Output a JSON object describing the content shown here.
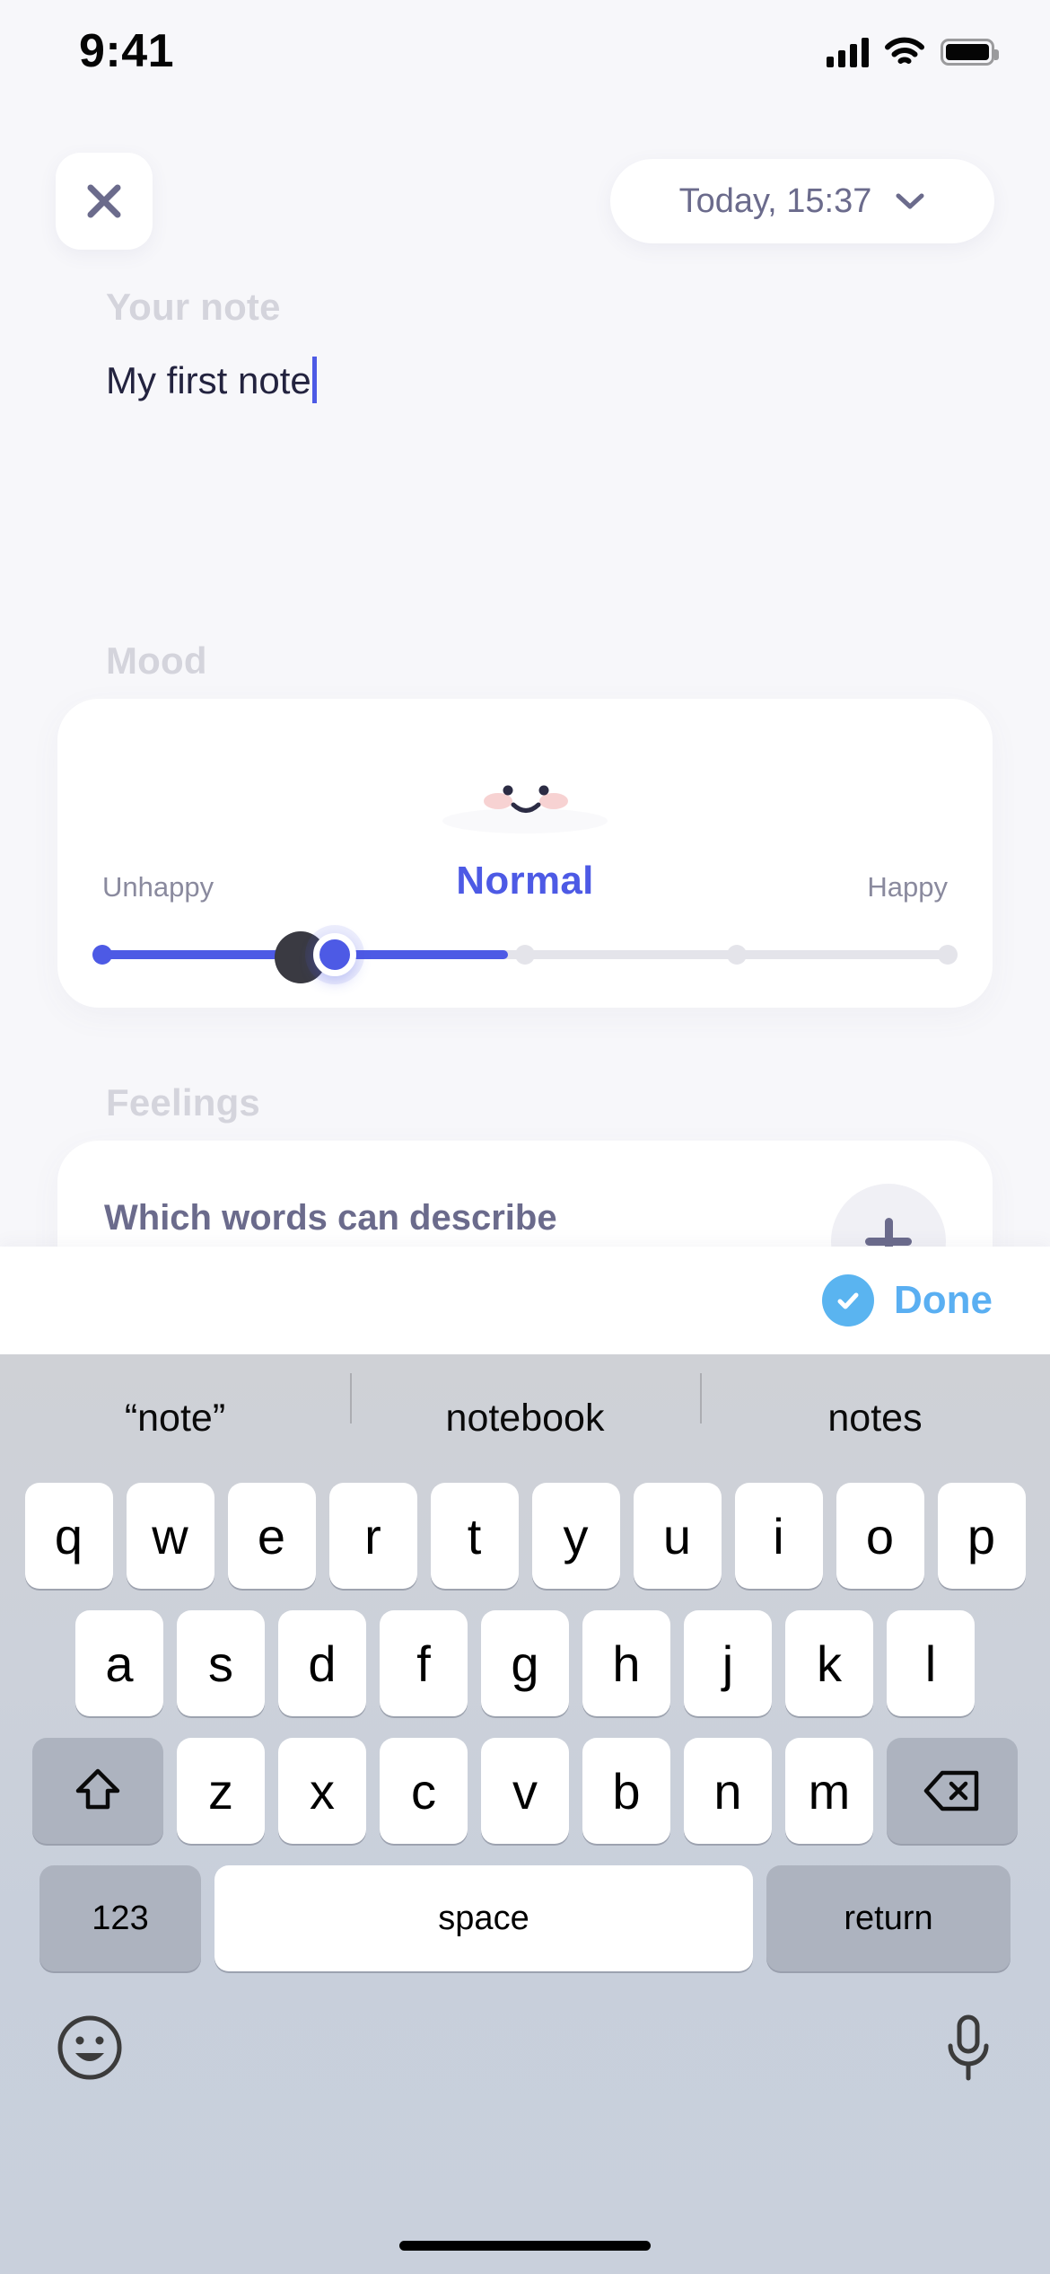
{
  "status_bar": {
    "time": "9:41",
    "cellular_icon": "signal-bars-icon",
    "wifi_icon": "wifi-icon",
    "battery_icon": "battery-icon"
  },
  "header": {
    "close_icon": "close-icon",
    "date_text": "Today, 15:37",
    "chevron_icon": "chevron-down-icon"
  },
  "note": {
    "label": "Your note",
    "value": "My first note"
  },
  "mood": {
    "label": "Mood",
    "emoji_icon": "cloud-smile-icon",
    "value": "Normal",
    "left_label": "Unhappy",
    "right_label": "Happy",
    "steps": 5,
    "selected_index": 2
  },
  "feelings": {
    "label": "Feelings",
    "question": "Which words can describe",
    "add_icon": "plus-icon"
  },
  "toolbar": {
    "done_label": "Done",
    "check_icon": "check-circle-icon"
  },
  "keyboard": {
    "suggestions": [
      "“note”",
      "notebook",
      "notes"
    ],
    "row1": [
      "q",
      "w",
      "e",
      "r",
      "t",
      "y",
      "u",
      "i",
      "o",
      "p"
    ],
    "row2": [
      "a",
      "s",
      "d",
      "f",
      "g",
      "h",
      "j",
      "k",
      "l"
    ],
    "row3": [
      "z",
      "x",
      "c",
      "v",
      "b",
      "n",
      "m"
    ],
    "shift_icon": "shift-arrow-icon",
    "backspace_icon": "backspace-icon",
    "numbers_label": "123",
    "space_label": "space",
    "return_label": "return",
    "emoji_icon": "emoji-smile-icon",
    "mic_icon": "microphone-icon"
  },
  "colors": {
    "accent": "#4d5ae5",
    "done_blue": "#5aaff2",
    "label_gray": "#d4d4dc",
    "text_dark": "#23233f",
    "muted": "#6b6b8c",
    "background": "#f7f7fa"
  }
}
